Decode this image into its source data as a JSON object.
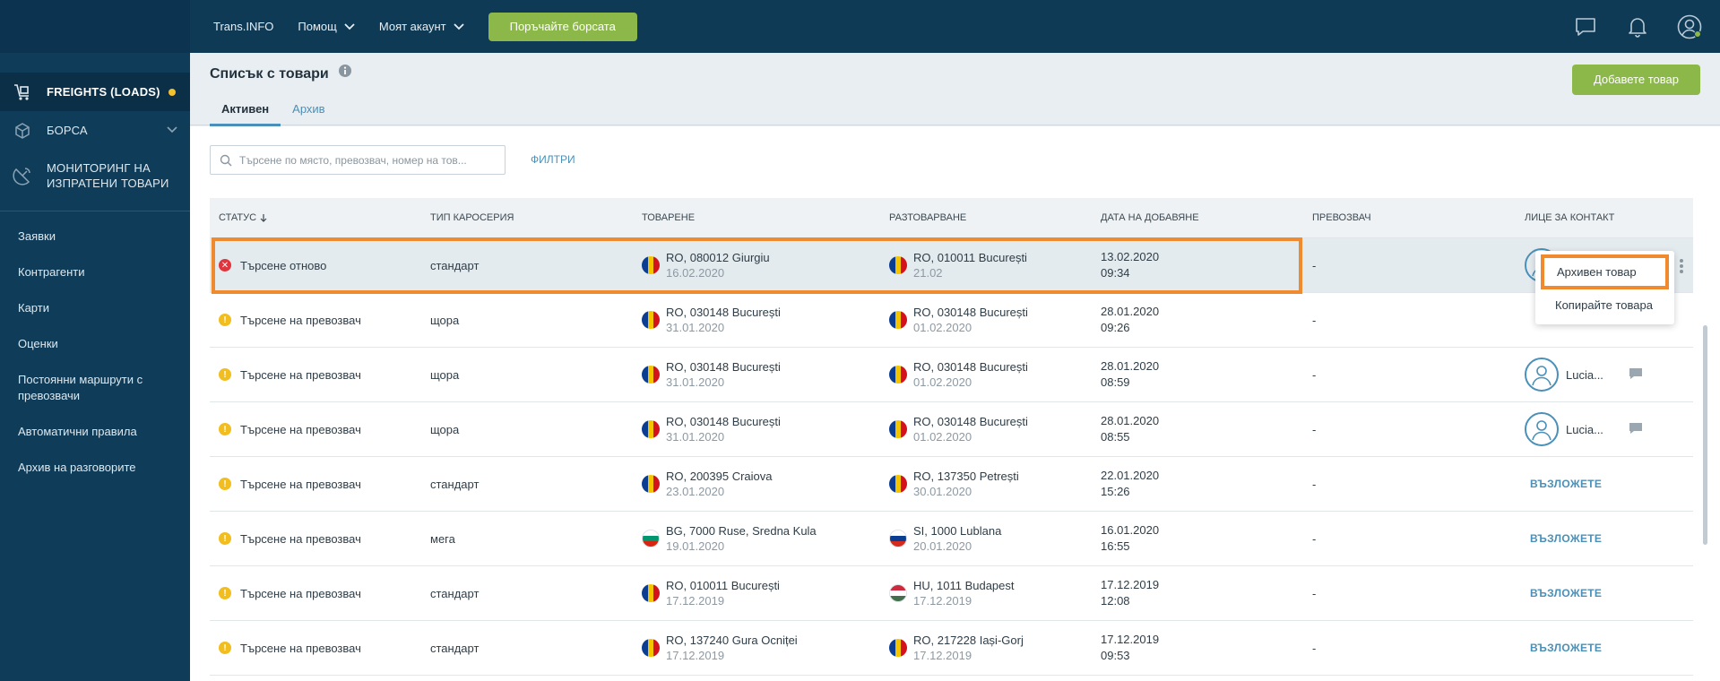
{
  "topbar": {
    "nav": [
      {
        "label": "Trans.INFO",
        "has_chevron": false
      },
      {
        "label": "Помощ",
        "has_chevron": true
      },
      {
        "label": "Моят акаунт",
        "has_chevron": true
      }
    ],
    "cta_label": "Поръчайте борсата",
    "icons": [
      "chat-icon",
      "bell-icon",
      "user-icon"
    ]
  },
  "sidebar": {
    "main_items": [
      {
        "label": "FREIGHTS (LOADS)",
        "icon": "freight-icon",
        "active": true,
        "badge": true
      },
      {
        "label": "БОРСА",
        "icon": "box-icon",
        "chevron": true
      },
      {
        "label_line1": "МОНИТОРИНГ НА",
        "label_line2": "ИЗПРАТЕНИ ТОВАРИ",
        "icon": "satellite-icon"
      }
    ],
    "sub_items": [
      "Заявки",
      "Контрагенти",
      "Карти",
      "Оценки",
      "Постоянни маршрути с превозвачи",
      "Автоматични правила",
      "Архив на разговорите"
    ]
  },
  "header": {
    "title": "Списък с товари",
    "tabs": [
      {
        "label": "Активен",
        "active": true
      },
      {
        "label": "Архив",
        "active": false
      }
    ],
    "add_button": "Добавете товар"
  },
  "search": {
    "placeholder": "Търсене по място, превозвач, номер на тов...",
    "filters_label": "ФИЛТРИ"
  },
  "table": {
    "columns": [
      "СТАТУС",
      "ТИП КАРОСЕРИЯ",
      "ТОВАРЕНЕ",
      "РАЗТОВАРВАНЕ",
      "ДАТА НА ДОБАВЯНЕ",
      "ПРЕВОЗВАЧ",
      "ЛИЦЕ ЗА КОНТАКТ"
    ],
    "rows": [
      {
        "status": "Търсене отново",
        "status_type": "err",
        "body": "стандарт",
        "load_place": "RO, 080012 Giurgiu",
        "load_date": "16.02.2020",
        "load_flag": "ro",
        "unload_place": "RO, 010011 București",
        "unload_date": "21.02",
        "unload_flag": "ro",
        "added_date": "13.02.2020",
        "added_time": "09:34",
        "carrier": "-",
        "contact_type": "avatar",
        "contact_name": ""
      },
      {
        "status": "Търсене на превозвач",
        "status_type": "warn",
        "body": "щора",
        "load_place": "RO, 030148 București",
        "load_date": "31.01.2020",
        "load_flag": "ro",
        "unload_place": "RO, 030148 București",
        "unload_date": "01.02.2020",
        "unload_flag": "ro",
        "added_date": "28.01.2020",
        "added_time": "09:26",
        "carrier": "-",
        "contact_type": "none",
        "contact_name": ""
      },
      {
        "status": "Търсене на превозвач",
        "status_type": "warn",
        "body": "щора",
        "load_place": "RO, 030148 București",
        "load_date": "31.01.2020",
        "load_flag": "ro",
        "unload_place": "RO, 030148 București",
        "unload_date": "01.02.2020",
        "unload_flag": "ro",
        "added_date": "28.01.2020",
        "added_time": "08:59",
        "carrier": "-",
        "contact_type": "person",
        "contact_name": "Lucia..."
      },
      {
        "status": "Търсене на превозвач",
        "status_type": "warn",
        "body": "щора",
        "load_place": "RO, 030148 București",
        "load_date": "31.01.2020",
        "load_flag": "ro",
        "unload_place": "RO, 030148 București",
        "unload_date": "01.02.2020",
        "unload_flag": "ro",
        "added_date": "28.01.2020",
        "added_time": "08:55",
        "carrier": "-",
        "contact_type": "person",
        "contact_name": "Lucia..."
      },
      {
        "status": "Търсене на превозвач",
        "status_type": "warn",
        "body": "стандарт",
        "load_place": "RO, 200395 Craiova",
        "load_date": "23.01.2020",
        "load_flag": "ro",
        "unload_place": "RO, 137350 Petrești",
        "unload_date": "30.01.2020",
        "unload_flag": "ro",
        "added_date": "22.01.2020",
        "added_time": "15:26",
        "carrier": "-",
        "contact_type": "link",
        "contact_name": "ВЪЗЛОЖЕТЕ"
      },
      {
        "status": "Търсене на превозвач",
        "status_type": "warn",
        "body": "мега",
        "load_place": "BG, 7000 Ruse, Sredna Kula",
        "load_date": "19.01.2020",
        "load_flag": "bg",
        "unload_place": "SI, 1000 Lublana",
        "unload_date": "20.01.2020",
        "unload_flag": "si",
        "added_date": "16.01.2020",
        "added_time": "16:55",
        "carrier": "-",
        "contact_type": "link",
        "contact_name": "ВЪЗЛОЖЕТЕ"
      },
      {
        "status": "Търсене на превозвач",
        "status_type": "warn",
        "body": "стандарт",
        "load_place": "RO, 010011 București",
        "load_date": "17.12.2019",
        "load_flag": "ro",
        "unload_place": "HU, 1011 Budapest",
        "unload_date": "17.12.2019",
        "unload_flag": "hu",
        "added_date": "17.12.2019",
        "added_time": "12:08",
        "carrier": "-",
        "contact_type": "link",
        "contact_name": "ВЪЗЛОЖЕТЕ"
      },
      {
        "status": "Търсене на превозвач",
        "status_type": "warn",
        "body": "стандарт",
        "load_place": "RO, 137240 Gura Ocniței",
        "load_date": "17.12.2019",
        "load_flag": "ro",
        "unload_place": "RO, 217228 Iași-Gorj",
        "unload_date": "17.12.2019",
        "unload_flag": "ro",
        "added_date": "17.12.2019",
        "added_time": "09:53",
        "carrier": "-",
        "contact_type": "link",
        "contact_name": "ВЪЗЛОЖЕТЕ"
      }
    ]
  },
  "dropdown": {
    "items": [
      "Архивен товар",
      "Копирайте товара"
    ]
  },
  "colors": {
    "topbar": "#0e3a55",
    "sidebar": "#0f3c58",
    "accent_green": "#8cb84a",
    "link_blue": "#4a90b8",
    "highlight_orange": "#f08a2e"
  }
}
